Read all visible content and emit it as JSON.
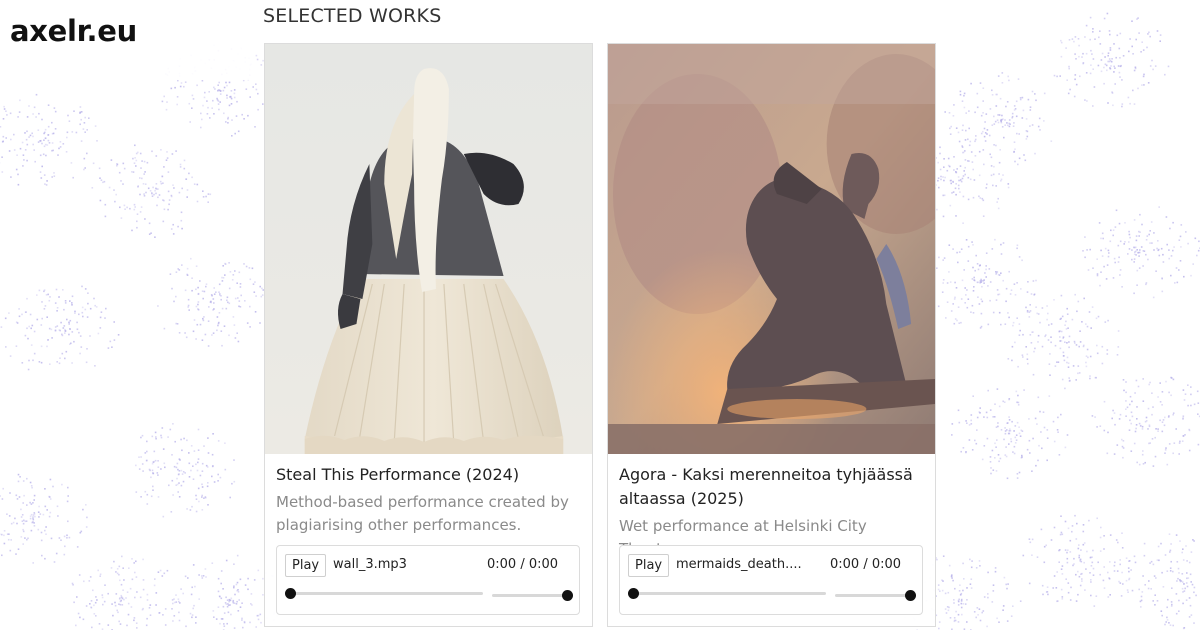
{
  "site": {
    "logo": "axelr.eu"
  },
  "section": {
    "title": "SELECTED WORKS"
  },
  "colors": {
    "dots": "#b9b3ea",
    "text": "#222222",
    "muted": "#8a8a8a"
  },
  "works": [
    {
      "title": "Steal This Performance (2024)",
      "description": "Method-based performance created by plagiarising other performances.",
      "image": "costume-dress-photo",
      "player": {
        "play_label": "Play",
        "file_name": "wall_3.mp3",
        "time": "0:00 / 0:00",
        "progress": 0,
        "volume": 1
      }
    },
    {
      "title": "Agora - Kaksi merenneitoa tyhjäässä altaassa (2025)",
      "description": "Wet performance at Helsinki City Theatre.",
      "image": "stage-performer-photo",
      "player": {
        "play_label": "Play",
        "file_name": "mermaids_death....",
        "time": "0:00 / 0:00",
        "progress": 0,
        "volume": 1
      }
    }
  ]
}
